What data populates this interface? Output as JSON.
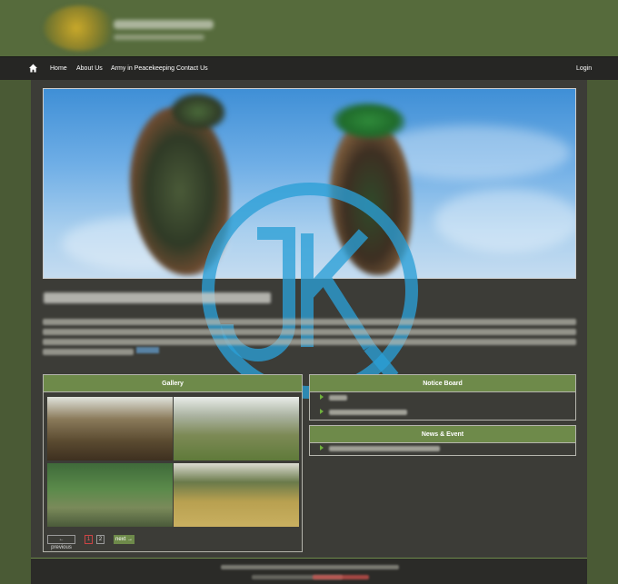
{
  "nav": {
    "home": "",
    "items": [
      "Home",
      "About Us",
      "Army in Peacekeeping",
      "Contact Us"
    ],
    "login": "Login"
  },
  "gallery": {
    "title": "Gallery",
    "prev_label": "← previous",
    "pages": [
      "1",
      "2"
    ],
    "next_label": "next →"
  },
  "notice_board": {
    "title": "Notice Board"
  },
  "news_event": {
    "title": "News & Event"
  },
  "colors": {
    "header": "#566b3c",
    "nav": "#262624",
    "panel_head": "#6e8a4a",
    "content": "#3c3c37",
    "watermark": "#2a9fd6"
  },
  "icons": [
    "home-icon",
    "watermark-logo",
    "bullet-icon"
  ]
}
